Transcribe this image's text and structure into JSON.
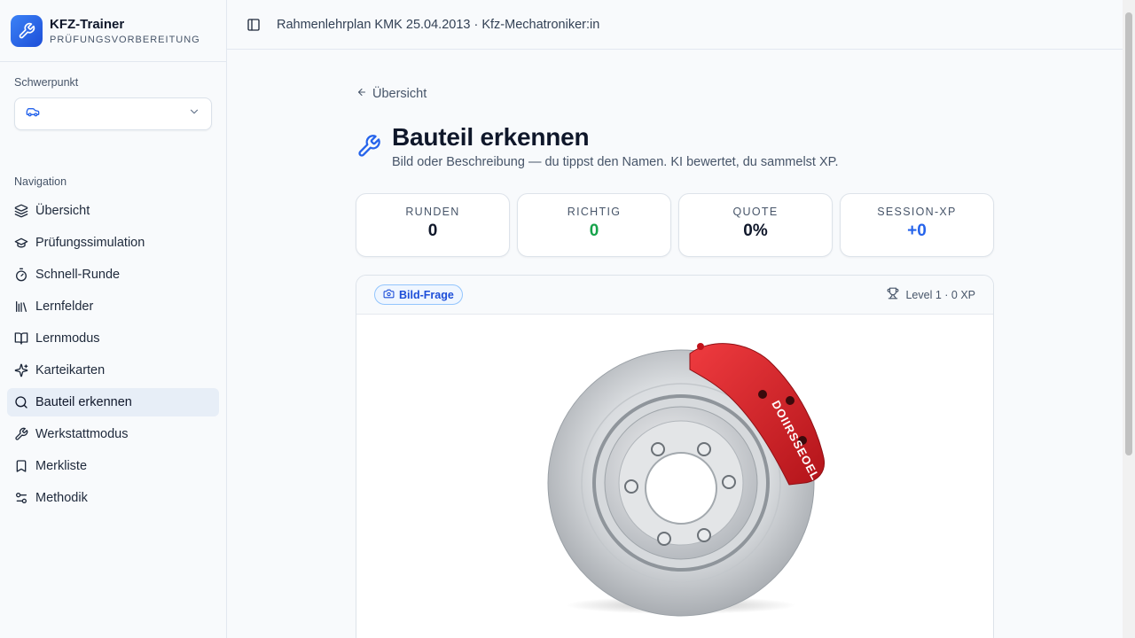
{
  "app": {
    "title": "KFZ-Trainer",
    "subtitle": "PRÜFUNGSVORBEREITUNG",
    "accent": "#2563eb"
  },
  "sidebar": {
    "focus_label": "Schwerpunkt",
    "focus_value_icon": "car-icon",
    "nav_label": "Navigation",
    "items": [
      {
        "label": "Übersicht",
        "icon": "layers-icon"
      },
      {
        "label": "Prüfungssimulation",
        "icon": "graduation-cap-icon"
      },
      {
        "label": "Schnell-Runde",
        "icon": "timer-icon"
      },
      {
        "label": "Lernfelder",
        "icon": "library-icon"
      },
      {
        "label": "Lernmodus",
        "icon": "book-open-icon"
      },
      {
        "label": "Karteikarten",
        "icon": "sparkles-icon"
      },
      {
        "label": "Bauteil erkennen",
        "icon": "search-icon",
        "active": true
      },
      {
        "label": "Werkstattmodus",
        "icon": "wrench-icon"
      },
      {
        "label": "Merkliste",
        "icon": "bookmark-icon"
      },
      {
        "label": "Methodik",
        "icon": "sliders-icon"
      }
    ]
  },
  "topbar": {
    "breadcrumb": "Rahmenlehrplan KMK 25.04.2013 · Kfz-Mechatroniker:in"
  },
  "main": {
    "back_label": "Übersicht",
    "title": "Bauteil erkennen",
    "subtitle": "Bild oder Beschreibung — du tippst den Namen. KI bewertet, du sammelst XP.",
    "stats": [
      {
        "label": "RUNDEN",
        "value": "0",
        "color": "#0f172a"
      },
      {
        "label": "RICHTIG",
        "value": "0",
        "color": "#16a34a"
      },
      {
        "label": "QUOTE",
        "value": "0%",
        "color": "#0f172a"
      },
      {
        "label": "SESSION-XP",
        "value": "+0",
        "color": "#2563eb"
      }
    ],
    "card": {
      "badge": "Bild-Frage",
      "level": "Level 1 · 0 XP",
      "caliper_text": "DOIIRSSEOEL",
      "caliper_color": "#d61f26"
    }
  }
}
